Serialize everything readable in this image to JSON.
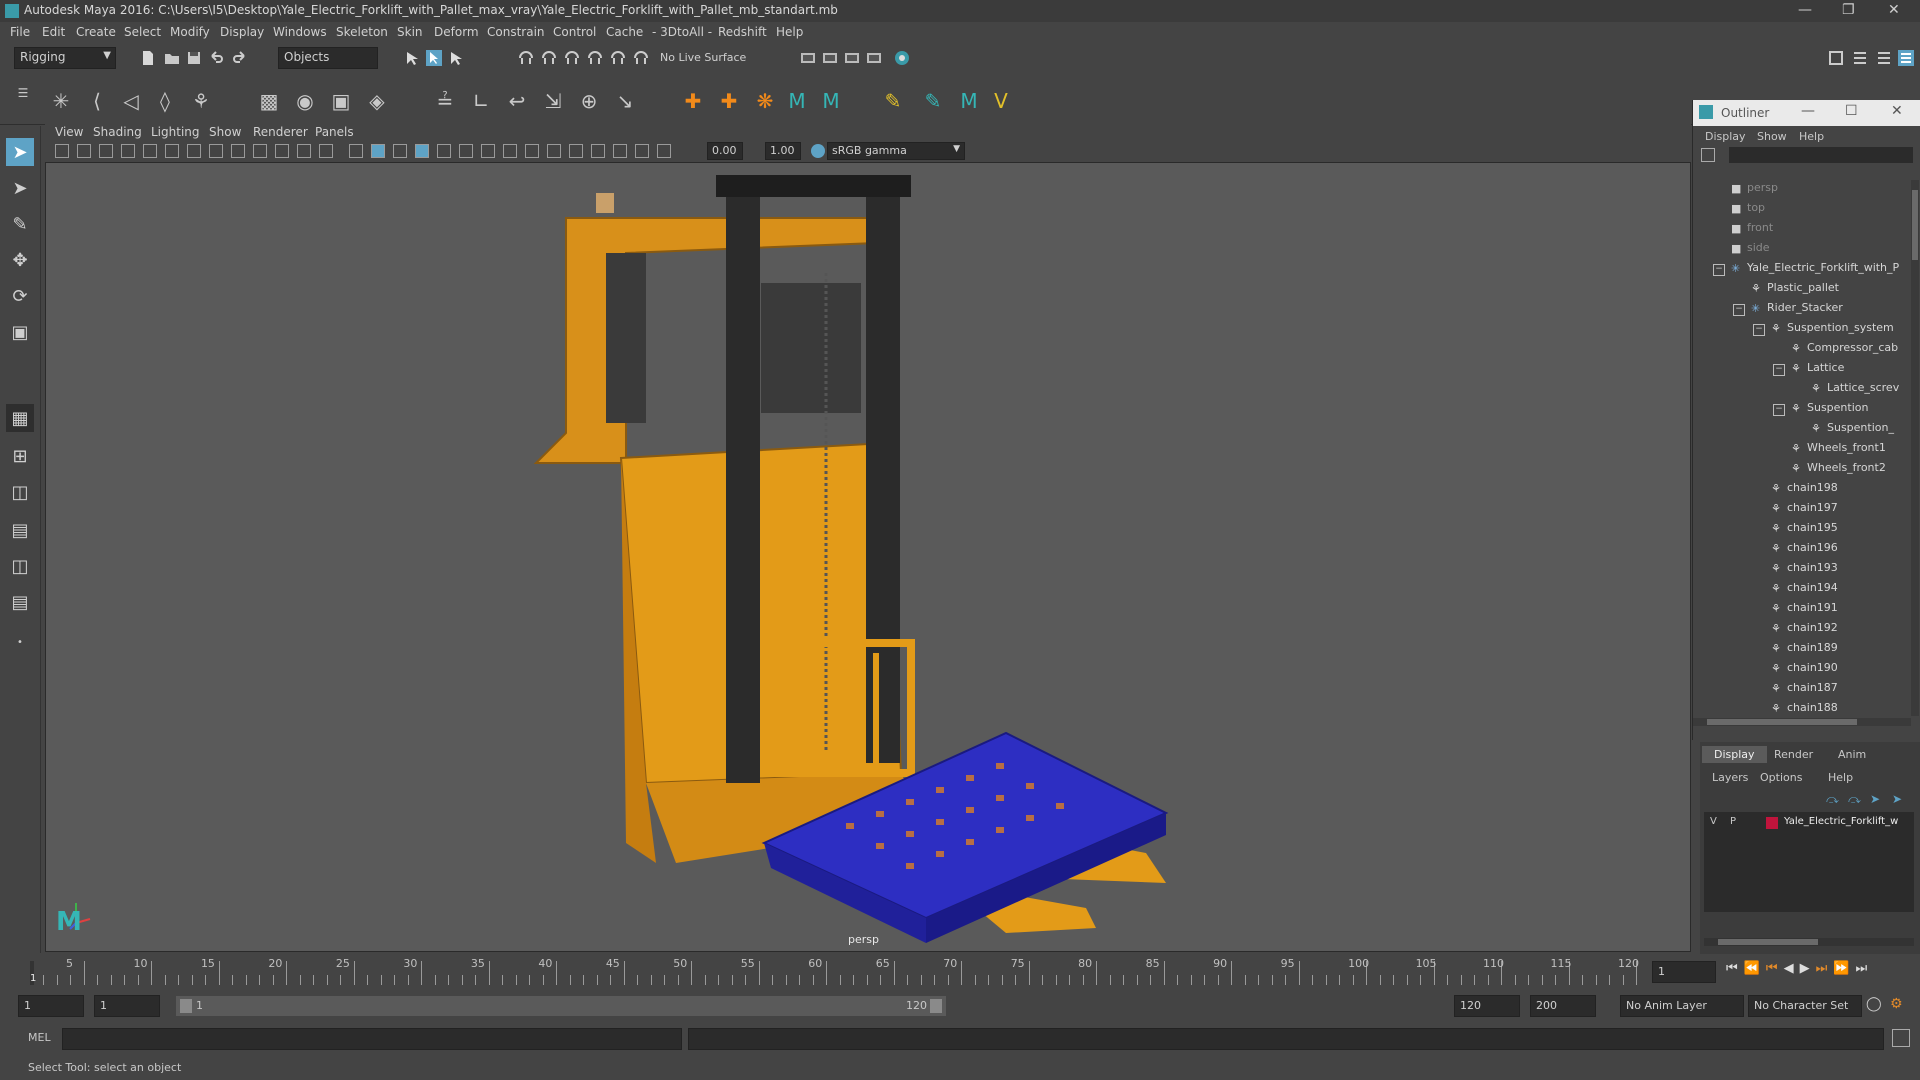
{
  "titlebar": {
    "title": "Autodesk Maya 2016: C:\\Users\\I5\\Desktop\\Yale_Electric_Forklift_with_Pallet_max_vray\\Yale_Electric_Forklift_with_Pallet_mb_standart.mb"
  },
  "menu": [
    "File",
    "Edit",
    "Create",
    "Select",
    "Modify",
    "Display",
    "Windows",
    "Skeleton",
    "Skin",
    "Deform",
    "Constrain",
    "Control",
    "Cache",
    "- 3DtoAll -",
    "Redshift",
    "Help"
  ],
  "statusline": {
    "menuset": "Rigging",
    "selection_mode": "Objects",
    "live_surface": "No Live Surface"
  },
  "viewport": {
    "menus": [
      "View",
      "Shading",
      "Lighting",
      "Show",
      "Renderer",
      "Panels"
    ],
    "exposure": "0.00",
    "gamma": "1.00",
    "colorspace": "sRGB gamma",
    "camera_label": "persp"
  },
  "outliner": {
    "title": "Outliner",
    "menus": [
      "Display",
      "Show",
      "Help"
    ],
    "items": [
      {
        "label": "persp",
        "depth": 0,
        "type": "camera",
        "expander": "none"
      },
      {
        "label": "top",
        "depth": 0,
        "type": "camera",
        "expander": "none"
      },
      {
        "label": "front",
        "depth": 0,
        "type": "camera",
        "expander": "none"
      },
      {
        "label": "side",
        "depth": 0,
        "type": "camera",
        "expander": "none"
      },
      {
        "label": "Yale_Electric_Forklift_with_P",
        "depth": 0,
        "type": "group",
        "expander": "minus"
      },
      {
        "label": "Plastic_pallet",
        "depth": 1,
        "type": "mesh",
        "expander": "none"
      },
      {
        "label": "Rider_Stacker",
        "depth": 1,
        "type": "group",
        "expander": "minus"
      },
      {
        "label": "Suspention_system",
        "depth": 2,
        "type": "mesh",
        "expander": "minus"
      },
      {
        "label": "Compressor_cab",
        "depth": 3,
        "type": "mesh",
        "expander": "none"
      },
      {
        "label": "Lattice",
        "depth": 3,
        "type": "mesh",
        "expander": "minus"
      },
      {
        "label": "Lattice_screv",
        "depth": 4,
        "type": "mesh",
        "expander": "none"
      },
      {
        "label": "Suspention",
        "depth": 3,
        "type": "mesh",
        "expander": "minus"
      },
      {
        "label": "Suspention_",
        "depth": 4,
        "type": "mesh",
        "expander": "none"
      },
      {
        "label": "Wheels_front1",
        "depth": 3,
        "type": "mesh",
        "expander": "none"
      },
      {
        "label": "Wheels_front2",
        "depth": 3,
        "type": "mesh",
        "expander": "none"
      },
      {
        "label": "chain198",
        "depth": 2,
        "type": "mesh",
        "expander": "none"
      },
      {
        "label": "chain197",
        "depth": 2,
        "type": "mesh",
        "expander": "none"
      },
      {
        "label": "chain195",
        "depth": 2,
        "type": "mesh",
        "expander": "none"
      },
      {
        "label": "chain196",
        "depth": 2,
        "type": "mesh",
        "expander": "none"
      },
      {
        "label": "chain193",
        "depth": 2,
        "type": "mesh",
        "expander": "none"
      },
      {
        "label": "chain194",
        "depth": 2,
        "type": "mesh",
        "expander": "none"
      },
      {
        "label": "chain191",
        "depth": 2,
        "type": "mesh",
        "expander": "none"
      },
      {
        "label": "chain192",
        "depth": 2,
        "type": "mesh",
        "expander": "none"
      },
      {
        "label": "chain189",
        "depth": 2,
        "type": "mesh",
        "expander": "none"
      },
      {
        "label": "chain190",
        "depth": 2,
        "type": "mesh",
        "expander": "none"
      },
      {
        "label": "chain187",
        "depth": 2,
        "type": "mesh",
        "expander": "none"
      },
      {
        "label": "chain188",
        "depth": 2,
        "type": "mesh",
        "expander": "none"
      }
    ]
  },
  "layer_editor": {
    "tabs": [
      "Display",
      "Render",
      "Anim"
    ],
    "active_tab": "Display",
    "menus": [
      "Layers",
      "Options",
      "Help"
    ],
    "layer": {
      "visible": "V",
      "playback": "P",
      "name": "Yale_Electric_Forklift_w",
      "color": "#c0143c"
    }
  },
  "timeline": {
    "ticks": [
      "5",
      "10",
      "15",
      "20",
      "25",
      "30",
      "35",
      "40",
      "45",
      "50",
      "55",
      "60",
      "65",
      "70",
      "75",
      "80",
      "85",
      "90",
      "95",
      "100",
      "105",
      "110",
      "115",
      "120"
    ],
    "current_frame_marker": "1",
    "current_frame_field": "1"
  },
  "range": {
    "start": "1",
    "playback_start": "1",
    "slider_start": "1",
    "slider_end": "120",
    "playback_end": "120",
    "end": "200",
    "anim_layer": "No Anim Layer",
    "character_set": "No Character Set"
  },
  "cmdline": {
    "label": "MEL"
  },
  "helpline": {
    "text": "Select Tool: select an object"
  },
  "colors": {
    "accent": "#5ea3c6",
    "forklift": "#e39b18",
    "pallet": "#2d2ec2",
    "layer": "#c0143c"
  }
}
